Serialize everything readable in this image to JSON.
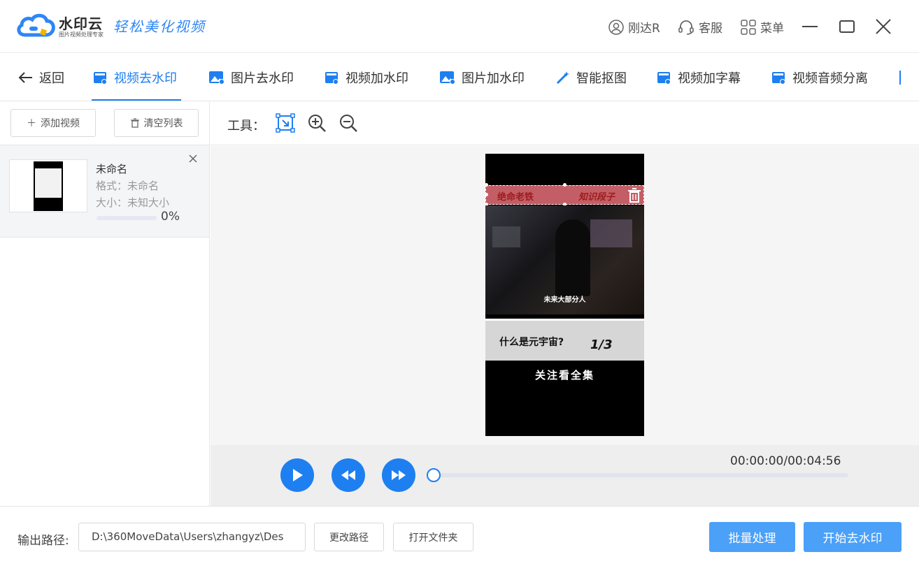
{
  "app": {
    "brand": "水印云",
    "brand_sub": "图片视频处理专家",
    "slogan": "轻松美化视频"
  },
  "titlebar": {
    "user": "刚达R",
    "service": "客服",
    "menu": "菜单"
  },
  "tabs": {
    "back": "返回",
    "items": [
      {
        "label": "视频去水印"
      },
      {
        "label": "图片去水印"
      },
      {
        "label": "视频加水印"
      },
      {
        "label": "图片加水印"
      },
      {
        "label": "智能抠图"
      },
      {
        "label": "视频加字幕"
      },
      {
        "label": "视频音频分离"
      }
    ]
  },
  "sidebar": {
    "add_video": "添加视频",
    "clear_list": "清空列表",
    "file": {
      "name": "未命名",
      "format": "格式：未命名",
      "size": "大小：未知大小",
      "progress_text": "0%",
      "progress": 0
    }
  },
  "tools": {
    "label": "工具："
  },
  "preview": {
    "watermark_left": "绝命老铁",
    "watermark_right": "知识段子",
    "subtitle": "未来大部分人",
    "question": "什么是元宇宙?",
    "episode": "1/3",
    "follow": "关注看全集"
  },
  "player": {
    "time": "00:00:00/00:04:56",
    "position": 0
  },
  "bottom": {
    "output_label": "输出路径:",
    "output_path": "D:\\360MoveData\\Users\\zhangyz\\Des",
    "change_path": "更改路径",
    "open_folder": "打开文件夹",
    "batch": "批量处理",
    "start": "开始去水印"
  },
  "colors": {
    "accent": "#1e7ff0",
    "primary_button": "#4ba0f8"
  }
}
